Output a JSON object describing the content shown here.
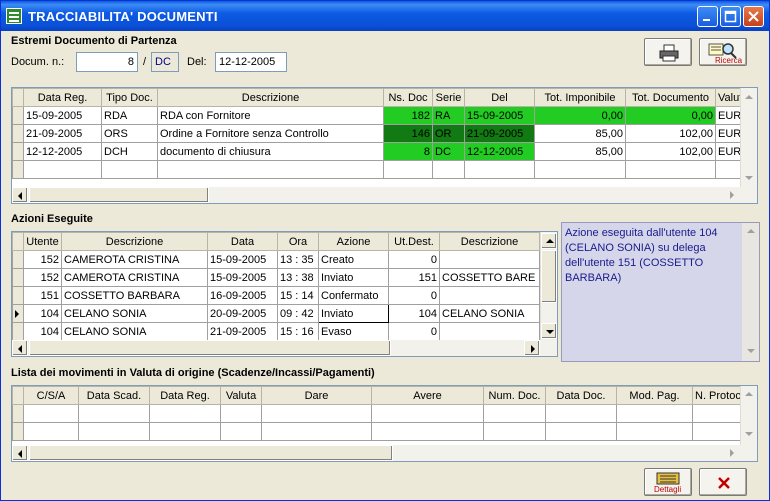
{
  "window": {
    "title": "TRACCIABILITA' DOCUMENTI"
  },
  "header": {
    "section_title": "Estremi Documento di Partenza",
    "docum_label": "Docum. n.:",
    "docum_number": "8",
    "separator": "/",
    "docum_series": "DC",
    "del_label": "Del:",
    "del_date": "12-12-2005",
    "ricerca_label": "Ricerca"
  },
  "documents": {
    "columns": [
      "Data Reg.",
      "Tipo Doc.",
      "Descrizione",
      "Ns. Doc",
      "Serie",
      "Del",
      "Tot. Imponibile",
      "Tot. Documento",
      "Valuta"
    ],
    "rows": [
      [
        "15-09-2005",
        "RDA",
        "RDA con Fornitore",
        "182",
        "RA",
        "15-09-2005",
        "0,00",
        "0,00",
        "EUR"
      ],
      [
        "21-09-2005",
        "ORS",
        "Ordine a Fornitore senza Controllo",
        "146",
        "OR",
        "21-09-2005",
        "85,00",
        "102,00",
        "EUR"
      ],
      [
        "12-12-2005",
        "DCH",
        "documento di chiusura",
        "8",
        "DC",
        "12-12-2005",
        "85,00",
        "102,00",
        "EUR"
      ]
    ]
  },
  "actions": {
    "section_title": "Azioni Eseguite",
    "columns": [
      "Utente",
      "Descrizione",
      "Data",
      "Ora",
      "Azione",
      "Ut.Dest.",
      "Descrizione"
    ],
    "rows": [
      [
        "152",
        "CAMEROTA CRISTINA",
        "15-09-2005",
        "13 : 35",
        "Creato",
        "0",
        ""
      ],
      [
        "152",
        "CAMEROTA CRISTINA",
        "15-09-2005",
        "13 : 38",
        "Inviato",
        "151",
        "COSSETTO BARE"
      ],
      [
        "151",
        "COSSETTO BARBARA",
        "16-09-2005",
        "15 : 14",
        "Confermato",
        "0",
        ""
      ],
      [
        "104",
        "CELANO SONIA",
        "20-09-2005",
        "09 : 42",
        "Inviato",
        "104",
        "CELANO SONIA"
      ],
      [
        "104",
        "CELANO SONIA",
        "21-09-2005",
        "15 : 16",
        "Evaso",
        "0",
        ""
      ]
    ],
    "note": "Azione eseguita dall'utente 104 (CELANO SONIA) su delega dell'utente 151 (COSSETTO BARBARA)"
  },
  "movements": {
    "section_title": "Lista dei movimenti in Valuta di origine (Scadenze/Incassi/Pagamenti)",
    "columns": [
      "C/S/A",
      "Data Scad.",
      "Data Reg.",
      "Valuta",
      "Dare",
      "Avere",
      "Num. Doc.",
      "Data Doc.",
      "Mod. Pag.",
      "N. Protoc"
    ]
  },
  "footer": {
    "dettagli_label": "Dettagli"
  }
}
